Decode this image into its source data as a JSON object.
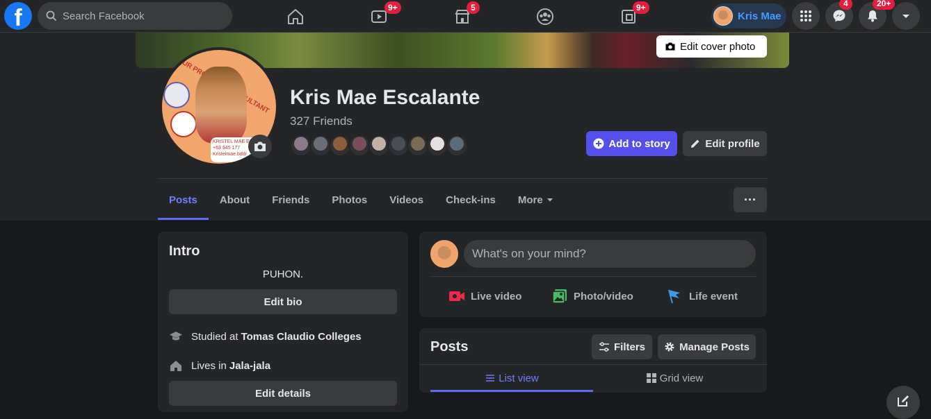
{
  "topbar": {
    "search_placeholder": "Search Facebook",
    "badges": {
      "watch": "9+",
      "marketplace": "5",
      "gaming": "9+"
    },
    "profile_name": "Kris Mae",
    "messenger_badge": "4",
    "notifications_badge": "20+"
  },
  "cover": {
    "edit_label": "Edit cover photo"
  },
  "profile": {
    "name": "Kris Mae Escalante",
    "friends_count": "327 Friends",
    "picture_text": {
      "arc": "YOUR PROPERTY CONSULTANT",
      "card_name": "KRISTEL MAE ES",
      "card_phone": "+63 945 177",
      "card_email": "Kristelmae.bddr"
    },
    "add_story_label": "Add to story",
    "edit_profile_label": "Edit profile",
    "friend_avatar_colors": [
      "#8a7a8a",
      "#6b6e78",
      "#8b5e3c",
      "#7a4e5a",
      "#c2b1a8",
      "#4a4f55",
      "#7c6a52",
      "#e6e0dc",
      "#5b6b7a"
    ]
  },
  "tabs": [
    {
      "label": "Posts",
      "active": true
    },
    {
      "label": "About"
    },
    {
      "label": "Friends"
    },
    {
      "label": "Photos"
    },
    {
      "label": "Videos"
    },
    {
      "label": "Check-ins"
    },
    {
      "label": "More"
    }
  ],
  "more_options_label": "···",
  "intro": {
    "title": "Intro",
    "bio": "PUHON.",
    "edit_bio_label": "Edit bio",
    "studied_prefix": "Studied at",
    "studied_value": "Tomas Claudio Colleges",
    "lives_prefix": "Lives in",
    "lives_value": "Jala-jala",
    "edit_details_label": "Edit details"
  },
  "composer": {
    "placeholder": "What's on your mind?",
    "live_video": "Live video",
    "photo_video": "Photo/video",
    "life_event": "Life event"
  },
  "posts_section": {
    "title": "Posts",
    "filters_label": "Filters",
    "manage_label": "Manage Posts",
    "list_view_label": "List view",
    "grid_view_label": "Grid view"
  },
  "colors": {
    "accent": "#5550eb",
    "badge": "#e41e3f",
    "surface": "#242526",
    "background": "#18191a"
  }
}
